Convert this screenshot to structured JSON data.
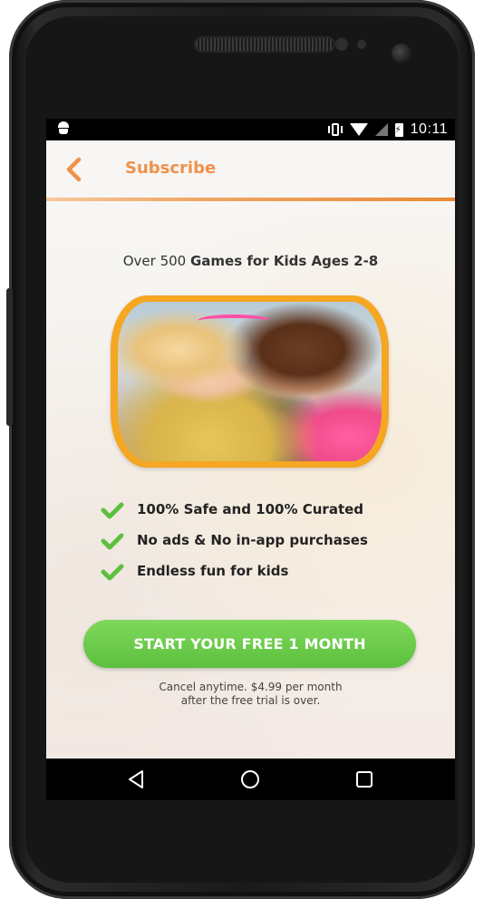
{
  "statusbar": {
    "time": "10:11",
    "icons": [
      "android-icon",
      "vibrate-icon",
      "wifi-icon",
      "signal-off-icon",
      "battery-charging-icon"
    ]
  },
  "appbar": {
    "back_icon": "chevron-left-icon",
    "title": "Subscribe"
  },
  "content": {
    "headline_prefix": "Over 500 ",
    "headline_bold": "Games for Kids Ages 2-8",
    "hero_image": "two-girls-playing-tablet-photo",
    "features": [
      {
        "icon": "check-icon",
        "label": "100% Safe and 100% Curated"
      },
      {
        "icon": "check-icon",
        "label": "No ads & No in-app purchases"
      },
      {
        "icon": "check-icon",
        "label": "Endless fun for kids"
      }
    ],
    "cta_label": "START YOUR FREE 1 MONTH",
    "terms_line1": "Cancel anytime. $4.99 per month",
    "terms_line2": "after the free trial is over."
  },
  "navbar": {
    "back": "triangle-back-icon",
    "home": "circle-home-icon",
    "recents": "square-recents-icon"
  },
  "colors": {
    "accent_orange": "#f0914a",
    "frame_orange": "#f5a623",
    "cta_green": "#5cc03f",
    "check_green": "#5cc03f"
  }
}
